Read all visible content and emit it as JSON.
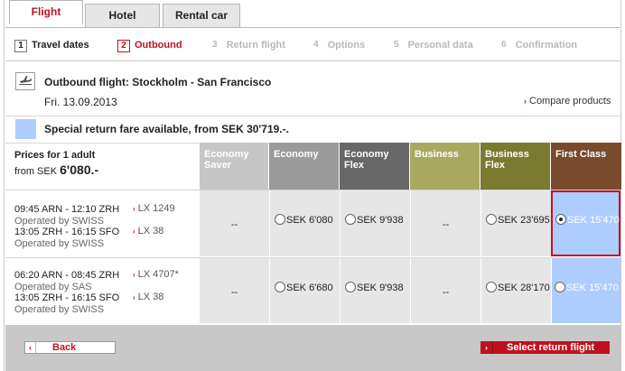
{
  "tabs": [
    {
      "label": "Flight",
      "active": true
    },
    {
      "label": "Hotel",
      "active": false
    },
    {
      "label": "Rental car",
      "active": false
    }
  ],
  "steps": [
    {
      "num": "1",
      "label": "Travel dates",
      "state": "done"
    },
    {
      "num": "2",
      "label": "Outbound",
      "state": "current"
    },
    {
      "num": "3",
      "label": "Return flight",
      "state": "future"
    },
    {
      "num": "4",
      "label": "Options",
      "state": "future"
    },
    {
      "num": "5",
      "label": "Personal data",
      "state": "future"
    },
    {
      "num": "6",
      "label": "Confirmation",
      "state": "future"
    }
  ],
  "flight": {
    "icon": "airplane-icon",
    "title": "Outbound flight: Stockholm - San Francisco",
    "date": "Fri. 13.09.2013",
    "compare_label": "Compare products"
  },
  "special": {
    "text": "Special return fare available, from SEK 30'719.-.",
    "swatch_color": "#aecdff"
  },
  "prices": {
    "label": "Prices for 1 adult",
    "from_prefix": "from SEK ",
    "from_value": "6'080.-"
  },
  "fare_columns": [
    {
      "name": "Economy Saver",
      "color": "#c6c6c6"
    },
    {
      "name": "Economy",
      "color": "#9a9a9a"
    },
    {
      "name": "Economy Flex",
      "color": "#676767"
    },
    {
      "name": "Business",
      "color": "#a8a860"
    },
    {
      "name": "Business Flex",
      "color": "#7a7a30"
    },
    {
      "name": "First Class",
      "color": "#7a4a2c"
    }
  ],
  "rows": [
    {
      "segments": [
        {
          "route": "09:45 ARN - 12:10 ZRH",
          "operator": "Operated by SWISS",
          "flight": "LX 1249"
        },
        {
          "route": "13:05 ZRH - 16:15 SFO",
          "operator": "Operated by SWISS",
          "flight": "LX 38"
        }
      ],
      "fares": [
        "--",
        "SEK 6'080",
        "SEK 9'938",
        "--",
        "SEK 23'695",
        "SEK 15'470"
      ],
      "selected": 5
    },
    {
      "segments": [
        {
          "route": "06:20 ARN - 08:45 ZRH",
          "operator": "Operated by SAS",
          "flight": "LX 4707*"
        },
        {
          "route": "13:05 ZRH - 16:15 SFO",
          "operator": "Operated by SWISS",
          "flight": "LX 38"
        }
      ],
      "fares": [
        "--",
        "SEK 6'680",
        "SEK 9'938",
        "--",
        "SEK 28'170",
        "SEK 15'470"
      ],
      "selected": -1
    }
  ],
  "footer": {
    "back_label": "Back",
    "next_label": "Select return flight"
  },
  "colors": {
    "accent": "#c0121d",
    "first_class_cell": "#aecdff"
  }
}
